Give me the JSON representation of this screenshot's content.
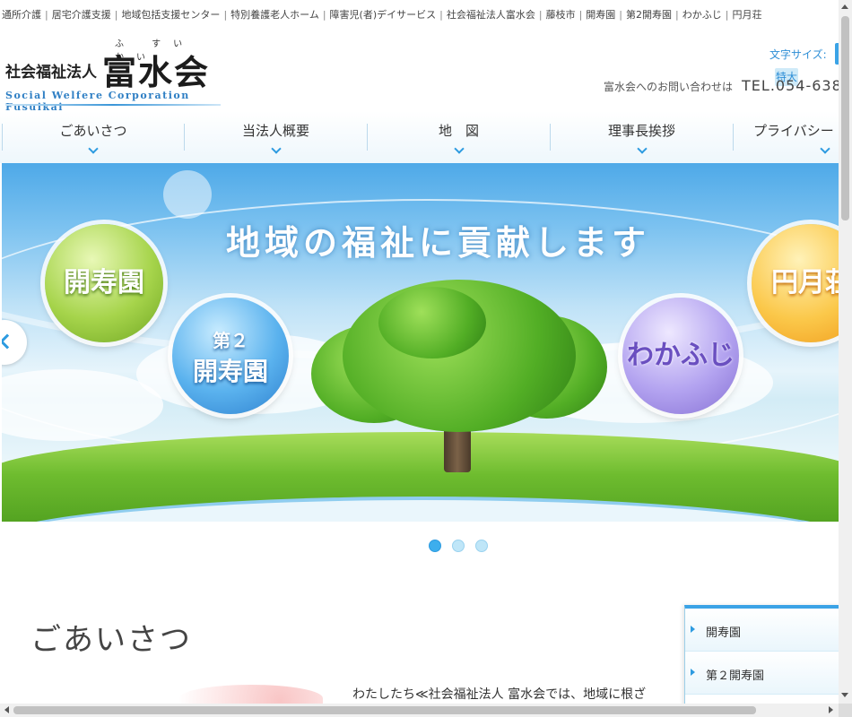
{
  "keywords": [
    "通所介護",
    "居宅介護支援",
    "地域包括支援センター",
    "特別養護老人ホーム",
    "障害児(者)デイサービス",
    "社会福祉法人富水会",
    "藤枝市",
    "開寿園",
    "第2開寿園",
    "わかふじ",
    "円月荘"
  ],
  "keyword_separator": "|",
  "logo": {
    "corp_type": "社会福祉法人",
    "name": "富水会",
    "furigana": "ふ すい かい",
    "english": "Social Welfere Corporation Fusuikai"
  },
  "font_size": {
    "label": "文字サイズ:",
    "large_button": "特大"
  },
  "contact": {
    "text": "富水会へのお問い合わせは",
    "tel": "TEL.054-638"
  },
  "nav": [
    {
      "label": "ごあいさつ"
    },
    {
      "label": "当法人概要"
    },
    {
      "label": "地　図"
    },
    {
      "label": "理事長挨拶"
    },
    {
      "label": "プライバシー"
    }
  ],
  "hero": {
    "headline": "地域の福祉に貢献します",
    "bubbles": {
      "kaijuen": "開寿園",
      "dai2_top": "第２",
      "dai2_bottom": "開寿園",
      "wakafuji": "わかふじ",
      "engetsu": "円月荘"
    }
  },
  "slider": {
    "slide_count": 3,
    "active_index": 0
  },
  "content": {
    "section_title": "ごあいさつ",
    "lead": "わたしたち≪社会福祉法人 富水会では、地域に根ざ"
  },
  "sidemenu": [
    {
      "label": "開寿園"
    },
    {
      "label": "第２開寿園"
    }
  ],
  "colors": {
    "accent": "#2d9be0",
    "nav_chevron": "#2d9be0",
    "logo_english": "#2f7fc4"
  }
}
